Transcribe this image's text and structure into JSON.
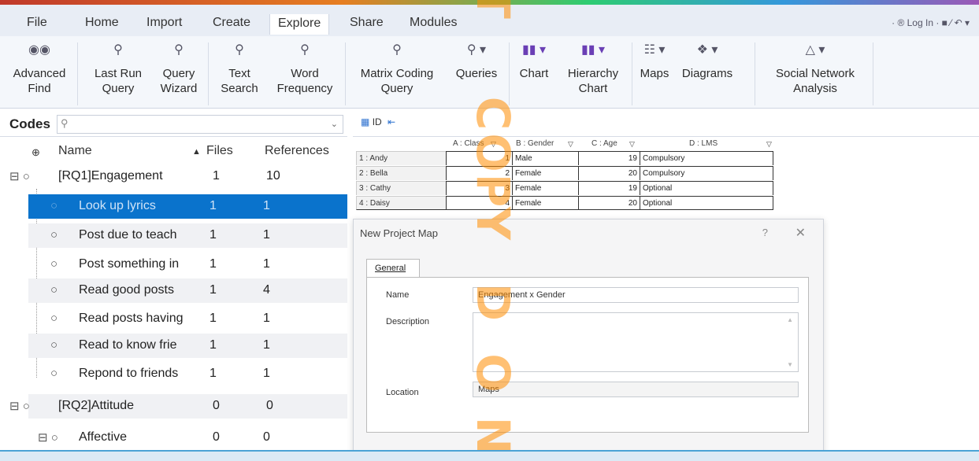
{
  "menu": {
    "file": "File",
    "tabs": [
      "Home",
      "Import",
      "Create",
      "Explore",
      "Share",
      "Modules"
    ],
    "active": "Explore",
    "account": "· ® Log In  · ■ ⁄ ↶ ▾"
  },
  "ribbon": {
    "buttons": [
      {
        "line1": "Advanced",
        "line2": "Find",
        "icon": "binoculars-icon"
      },
      {
        "line1": "Last Run",
        "line2": "Query",
        "icon": "last-run-query-icon"
      },
      {
        "line1": "Query",
        "line2": "Wizard",
        "icon": "query-wizard-icon"
      },
      {
        "line1": "Text",
        "line2": "Search",
        "icon": "text-search-icon"
      },
      {
        "line1": "Word",
        "line2": "Frequency",
        "icon": "word-frequency-icon"
      },
      {
        "line1": "Matrix Coding",
        "line2": "Query",
        "icon": "matrix-coding-icon"
      },
      {
        "line1": "Queries",
        "line2": "",
        "icon": "queries-icon"
      },
      {
        "line1": "Chart",
        "line2": "",
        "icon": "chart-icon"
      },
      {
        "line1": "Hierarchy",
        "line2": "Chart",
        "icon": "hierarchy-chart-icon"
      },
      {
        "line1": "Maps",
        "line2": "",
        "icon": "maps-icon"
      },
      {
        "line1": "Diagrams",
        "line2": "",
        "icon": "diagrams-icon"
      },
      {
        "line1": "Social Network",
        "line2": "Analysis",
        "icon": "social-network-icon"
      }
    ]
  },
  "codes": {
    "title": "Codes",
    "columns": {
      "name": "Name",
      "files": "Files",
      "refs": "References"
    },
    "rows": [
      {
        "name": "[RQ1]Engagement",
        "files": "1",
        "refs": "10"
      },
      {
        "name": "Look up lyrics",
        "files": "1",
        "refs": "1"
      },
      {
        "name": "Post due to teach",
        "files": "1",
        "refs": "1"
      },
      {
        "name": "Post something in",
        "files": "1",
        "refs": "1"
      },
      {
        "name": "Read good posts",
        "files": "1",
        "refs": "4"
      },
      {
        "name": "Read posts having",
        "files": "1",
        "refs": "1"
      },
      {
        "name": "Read to know frie",
        "files": "1",
        "refs": "1"
      },
      {
        "name": "Repond to friends",
        "files": "1",
        "refs": "1"
      },
      {
        "name": "[RQ2]Attitude",
        "files": "0",
        "refs": "0"
      },
      {
        "name": "Affective",
        "files": "0",
        "refs": "0"
      }
    ]
  },
  "detail": {
    "tab": "ID",
    "grid": {
      "headers": [
        "A : Class",
        "B : Gender",
        "C : Age",
        "D : LMS"
      ],
      "rows": [
        {
          "label": "1 : Andy",
          "class": "1",
          "gender": "Male",
          "age": "19",
          "lms": "Compulsory"
        },
        {
          "label": "2 : Bella",
          "class": "2",
          "gender": "Female",
          "age": "20",
          "lms": "Compulsory"
        },
        {
          "label": "3 : Cathy",
          "class": "3",
          "gender": "Female",
          "age": "19",
          "lms": "Optional"
        },
        {
          "label": "4 : Daisy",
          "class": "4",
          "gender": "Female",
          "age": "20",
          "lms": "Optional"
        }
      ]
    }
  },
  "dialog": {
    "title": "New Project Map",
    "help": "?",
    "close": "✕",
    "tab": "General",
    "name_label": "Name",
    "name_value": "Engagement x Gender",
    "description_label": "Description",
    "description_value": "",
    "location_label": "Location",
    "location_value": "Maps"
  },
  "watermark": [
    "T",
    "C",
    "O",
    "P",
    "Y",
    "D",
    "O",
    "N"
  ]
}
